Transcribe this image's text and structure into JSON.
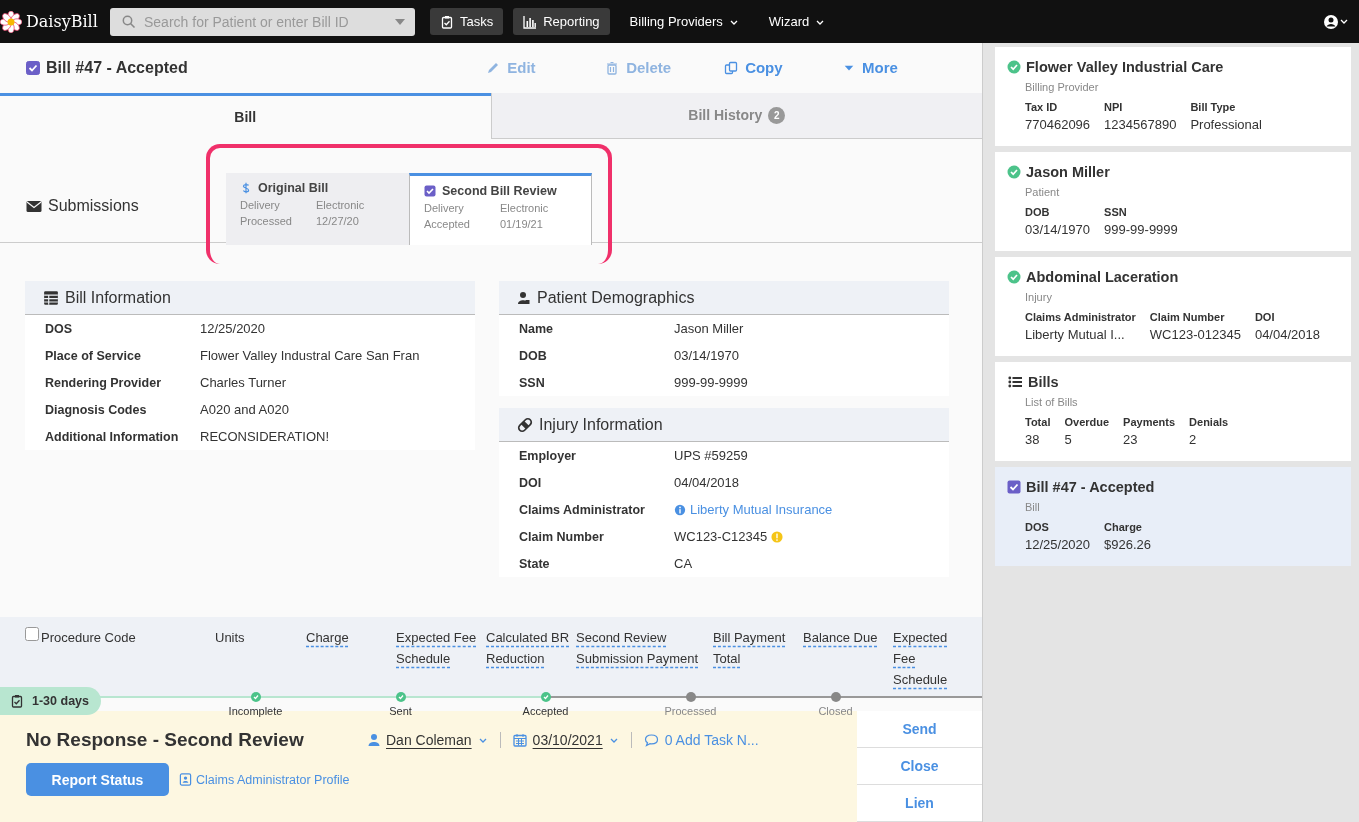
{
  "topbar": {
    "brand": "DaisyBill",
    "search": {
      "placeholder": "Search for Patient or enter Bill ID"
    },
    "nav": [
      {
        "label": "Tasks",
        "kind": "button"
      },
      {
        "label": "Reporting",
        "kind": "button"
      },
      {
        "label": "Billing Providers",
        "kind": "menu"
      },
      {
        "label": "Wizard",
        "kind": "menu"
      }
    ]
  },
  "header": {
    "title": "Bill #47 - Accepted",
    "checked": true,
    "actions": [
      {
        "label": "Edit",
        "disabled": true
      },
      {
        "label": "Delete",
        "disabled": true
      },
      {
        "label": "Copy",
        "disabled": false
      },
      {
        "label": "More",
        "disabled": false
      }
    ]
  },
  "tabs": [
    {
      "label": "Bill",
      "selected": true
    },
    {
      "label": "Bill History",
      "badge": "2",
      "selected": false
    }
  ],
  "submissions": {
    "label": "Submissions",
    "items": [
      {
        "title": "Original Bill",
        "kind": "payment",
        "selected": false,
        "rows": [
          [
            "Delivery",
            "Electronic"
          ],
          [
            "Processed",
            "12/27/20"
          ]
        ]
      },
      {
        "title": "Second Bill Review",
        "kind": "review",
        "selected": true,
        "rows": [
          [
            "Delivery",
            "Electronic"
          ],
          [
            "Accepted",
            "01/19/21"
          ]
        ]
      }
    ]
  },
  "panels": [
    {
      "title": "Bill Information",
      "rows": [
        {
          "label": "DOS",
          "value": "12/25/2020",
          "kind": "text"
        },
        {
          "label": "Place of Service",
          "value": "Flower Valley Industral Care San Fran",
          "kind": "text"
        },
        {
          "label": "Rendering Provider",
          "value": "Charles Turner",
          "kind": "text"
        },
        {
          "label": "Diagnosis Codes",
          "value": "A020 and A020",
          "kind": "text"
        },
        {
          "label": "Additional Information",
          "value": "RECONSIDERATION!",
          "kind": "text"
        }
      ]
    },
    {
      "title": "Patient Demographics",
      "rows": [
        {
          "label": "Name",
          "value": "Jason Miller",
          "kind": "text"
        },
        {
          "label": "DOB",
          "value": "03/14/1970",
          "kind": "text"
        },
        {
          "label": "SSN",
          "value": "999-99-9999",
          "kind": "text"
        }
      ]
    },
    {
      "title": "Injury Information",
      "rows": [
        {
          "label": "Employer",
          "value": "UPS #59259",
          "kind": "text"
        },
        {
          "label": "DOI",
          "value": "04/04/2018",
          "kind": "text"
        },
        {
          "label": "Claims Administrator",
          "value": "Liberty Mutual Insurance",
          "kind": "link"
        },
        {
          "label": "Claim Number",
          "value": "WC123-C12345",
          "kind": "flagged"
        },
        {
          "label": "State",
          "value": "CA",
          "kind": "text"
        }
      ]
    }
  ],
  "table": {
    "select_all": {
      "checked": false
    },
    "columns": [
      {
        "label": "Procedure Code",
        "dashed": false
      },
      {
        "label": "Units",
        "dashed": false
      },
      {
        "label": "Charge",
        "dashed": true
      },
      {
        "label": "Expected Fee Schedule",
        "dashed": true
      },
      {
        "label": "Calculated BR Reduction",
        "dashed": true
      },
      {
        "label": "Second Review Submission Payment",
        "dashed": true
      },
      {
        "label": "Bill Payment Total",
        "dashed": true
      },
      {
        "label": "Balance Due",
        "dashed": true
      },
      {
        "label": "Expected Fee Schedule",
        "dashed": true
      }
    ]
  },
  "status": {
    "age": "1-30 days",
    "steps": [
      {
        "label": "Incomplete",
        "done": true
      },
      {
        "label": "Sent",
        "done": true
      },
      {
        "label": "Accepted",
        "done": true
      },
      {
        "label": "Processed",
        "done": false
      },
      {
        "label": "Closed",
        "done": false
      }
    ],
    "title": "No Response - Second Review",
    "assignee": "Dan Coleman",
    "due": "03/10/2021",
    "tasks": "0 Add Task N...",
    "primary": "Report Status",
    "link": "Claims Administrator Profile",
    "side_buttons": [
      "Send",
      "Close",
      "Lien"
    ]
  },
  "sidebar": [
    {
      "title": "Billing Provider",
      "name": "Flower Valley Industrial Care",
      "kind": "verified",
      "selected": false,
      "fields": [
        [
          "Tax ID",
          "770462096"
        ],
        [
          "NPI",
          "1234567890"
        ],
        [
          "Bill Type",
          "Professional"
        ]
      ]
    },
    {
      "title": "Patient",
      "name": "Jason Miller",
      "kind": "verified",
      "selected": false,
      "fields": [
        [
          "DOB",
          "03/14/1970"
        ],
        [
          "SSN",
          "999-99-9999"
        ]
      ]
    },
    {
      "title": "Injury",
      "name": "Abdominal Laceration",
      "kind": "verified",
      "selected": false,
      "fields": [
        [
          "Claims Administrator",
          "Liberty Mutual I..."
        ],
        [
          "Claim Number",
          "WC123-012345"
        ],
        [
          "DOI",
          "04/04/2018"
        ]
      ]
    },
    {
      "title": "List of Bills",
      "name": "Bills",
      "kind": "list",
      "selected": false,
      "fields": [
        [
          "Total",
          "38"
        ],
        [
          "Overdue",
          "5"
        ],
        [
          "Payments",
          "23"
        ],
        [
          "Denials",
          "2"
        ]
      ]
    },
    {
      "title": "Bill",
      "name": "Bill #47 - Accepted",
      "kind": "bill",
      "selected": true,
      "fields": [
        [
          "DOS",
          "12/25/2020"
        ],
        [
          "Charge",
          "$926.26"
        ]
      ]
    }
  ]
}
